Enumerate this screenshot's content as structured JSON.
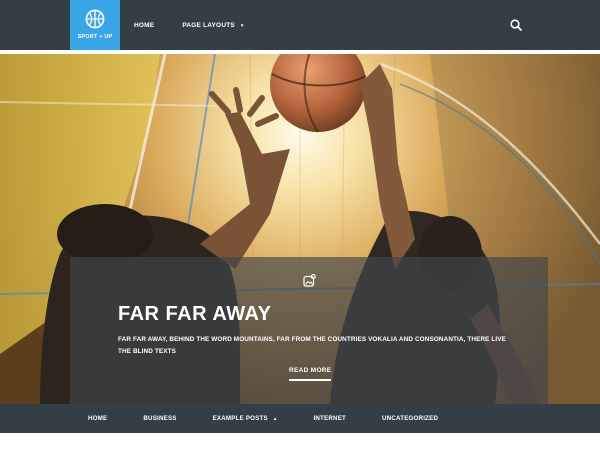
{
  "site": {
    "logo_text": "SPORT + UP",
    "logo_icon": "basketball-icon",
    "accent_color": "#3aa6e6",
    "nav_bg_color": "#343e47"
  },
  "top_nav": {
    "items": [
      {
        "label": "HOME"
      },
      {
        "label": "PAGE LAYOUTS",
        "caret": "▼"
      }
    ],
    "search_icon": "search-icon"
  },
  "hero": {
    "image_icon": "basketball-players-photo",
    "format_icon": "image-format-icon",
    "title": "FAR FAR AWAY",
    "excerpt": "FAR FAR AWAY, BEHIND THE WORD MOUNTAINS, FAR FROM THE COUNTRIES VOKALIA AND CONSONANTIA, THERE LIVE THE BLIND TEXTS",
    "read_more": "READ MORE"
  },
  "bottom_nav": {
    "items": [
      {
        "label": "HOME"
      },
      {
        "label": "BUSINESS"
      },
      {
        "label": "EXAMPLE POSTS",
        "caret": "▲"
      },
      {
        "label": "INTERNET"
      },
      {
        "label": "UNCATEGORIZED"
      }
    ]
  }
}
